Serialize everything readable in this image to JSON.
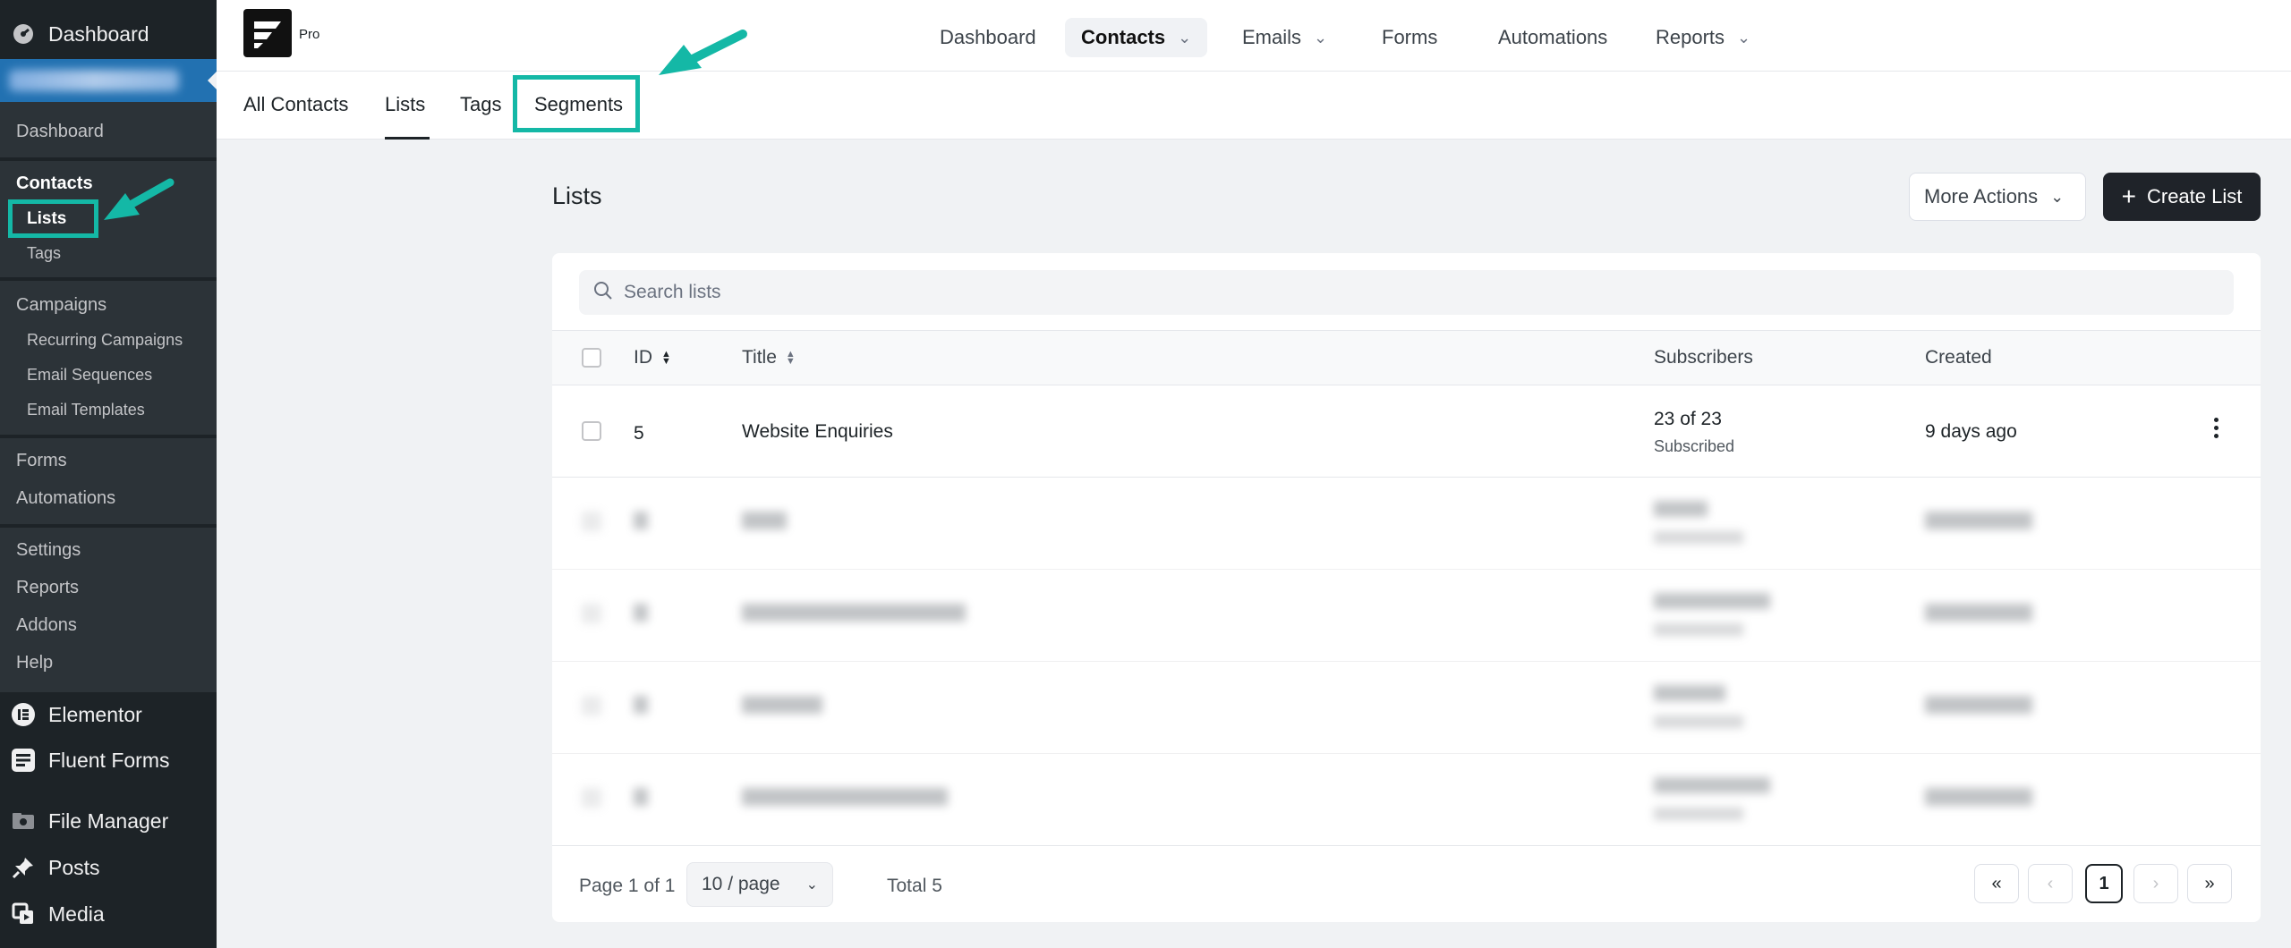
{
  "wp_menu": {
    "dashboard": "Dashboard",
    "fluentcrm_items": [
      "Dashboard",
      "Contacts",
      "Lists",
      "Tags",
      "Campaigns",
      "Recurring Campaigns",
      "Email Sequences",
      "Email Templates",
      "Forms",
      "Automations",
      "Settings",
      "Reports",
      "Addons",
      "Help"
    ],
    "plugins": [
      "Elementor",
      "Fluent Forms",
      "File Manager",
      "Posts",
      "Media"
    ]
  },
  "brand": {
    "badge": "Pro"
  },
  "top_nav": {
    "items": [
      "Dashboard",
      "Contacts",
      "Emails",
      "Forms",
      "Automations",
      "Reports"
    ],
    "active": "Contacts"
  },
  "sub_nav": {
    "tabs": [
      "All Contacts",
      "Lists",
      "Tags",
      "Segments"
    ],
    "active": "Lists"
  },
  "page": {
    "title": "Lists",
    "more_actions": "More Actions",
    "create_button": "Create List"
  },
  "search": {
    "placeholder": "Search lists"
  },
  "table": {
    "columns": [
      "ID",
      "Title",
      "Subscribers",
      "Created"
    ],
    "rows": [
      {
        "id": "5",
        "title": "Website Enquiries",
        "subscribers": "23 of 23",
        "status": "Subscribed",
        "created": "9 days ago"
      }
    ]
  },
  "pagination": {
    "page_info": "Page 1 of 1",
    "per_page": "10 / page",
    "total": "Total 5",
    "current": "1"
  },
  "colors": {
    "highlight": "#14b8a6",
    "wp_sidebar": "#1d2327",
    "wp_active": "#2271b1",
    "primary_button": "#1f2329"
  }
}
